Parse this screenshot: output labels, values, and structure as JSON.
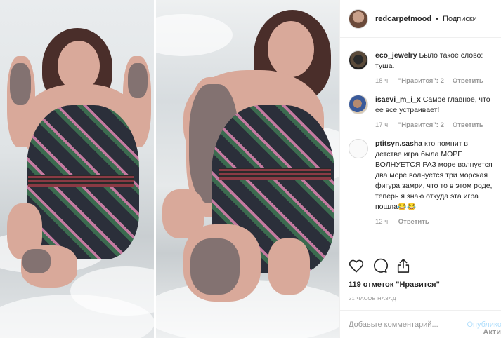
{
  "post": {
    "username": "redcarpetmood",
    "separator": "•",
    "follow_label": "Подписки"
  },
  "comments": [
    {
      "username": "eco_jewelry",
      "text": "Было такое слово: туша.",
      "time": "18 ч.",
      "likes": "\"Нравится\": 2",
      "reply": "Ответить"
    },
    {
      "username": "isaevi_m_i_x",
      "text": "Самое главное, что ее все устраивает!",
      "time": "17 ч.",
      "likes": "\"Нравится\": 2",
      "reply": "Ответить"
    },
    {
      "username": "ptitsyn.sasha",
      "text": "кто помнит в детстве игра была МОРЕ ВОЛНУЕТСЯ РАЗ море волнуется два море волнуется три морская фигура замри, что то в этом роде, теперь я знаю откуда эта игра пошла😂😂",
      "time": "12 ч.",
      "reply": "Ответить"
    }
  ],
  "stats": {
    "likes": "119 отметок \"Нравится\"",
    "time_ago": "21 ЧАСОВ НАЗАД"
  },
  "add_comment": {
    "placeholder": "Добавьте комментарий...",
    "publish_label": "Опублико"
  },
  "watermark": "Акти",
  "icons": {
    "like": "heart-icon",
    "comment": "comment-bubble-icon",
    "share": "share-icon"
  }
}
